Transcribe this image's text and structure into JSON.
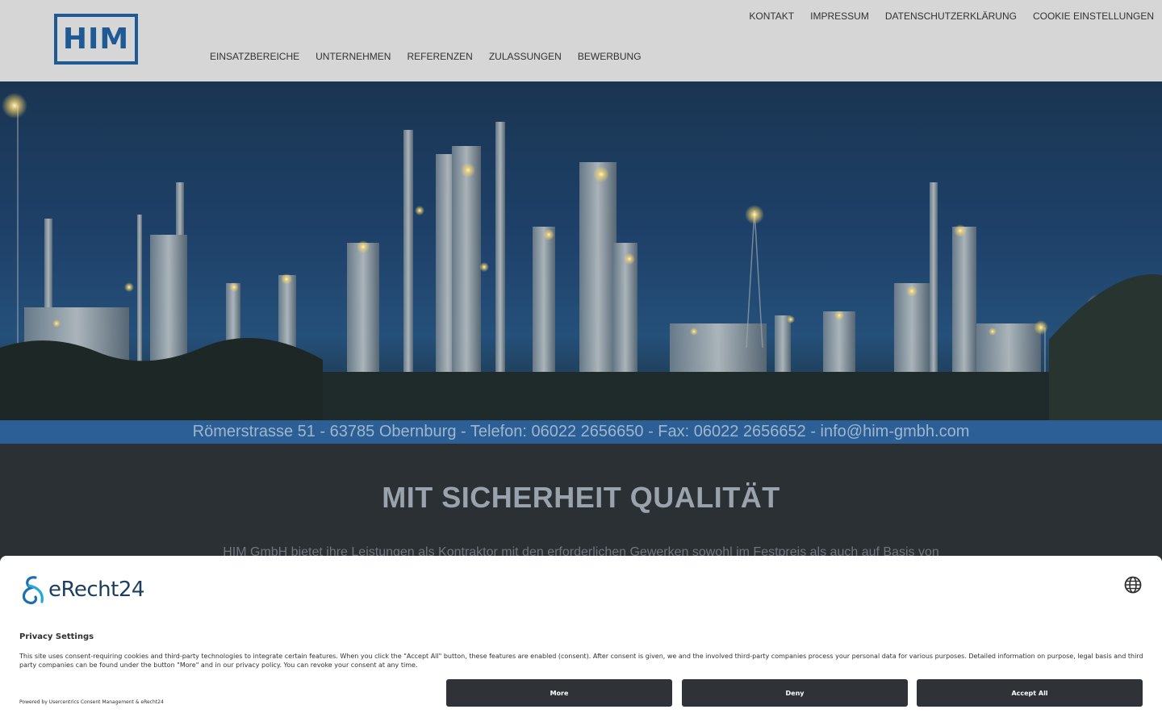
{
  "header": {
    "logo_text": "HIM",
    "brand_color": "#1f5a94",
    "top_nav": [
      "KONTAKT",
      "IMPRESSUM",
      "DATENSCHUTZERKLÄRUNG",
      "COOKIE EINSTELLUNGEN"
    ],
    "main_nav": [
      "EINSATZBEREICHE",
      "UNTERNEHMEN",
      "REFERENZEN",
      "ZULASSUNGEN",
      "BEWERBUNG"
    ]
  },
  "hero": {
    "image_subject": "refinery-at-night"
  },
  "address_bar": {
    "text": "Römerstrasse 51 - 63785 Obernburg - Telefon: 06022 2656650 - Fax: 06022 2656652 - info@him-gmbh.com"
  },
  "content": {
    "slogan": "MIT SICHERHEIT QUALITÄT",
    "intro": "HIM GmbH bietet ihre Leistungen als Kontraktor mit den erforderlichen Gewerken sowohl im Festpreis als auch auf Basis von"
  },
  "consent": {
    "brand_name": "eRecht24",
    "title": "Privacy Settings",
    "text": "This site uses consent-requiring cookies and third-party technologies to integrate certain features. When you click the \"Accept All\" button, these features are enabled (consent). After consent is given, we and the involved third-party companies process your personal data for various purposes. Detailed information on purpose, legal basis and third party companies can be found under the button \"More\" and in our privacy policy. You can revoke your consent at any time.",
    "powered_by": "Powered by Usercentrics Consent Management & eRecht24",
    "buttons": {
      "more": "More",
      "deny": "Deny",
      "accept": "Accept All"
    },
    "language_icon": "globe-icon"
  }
}
